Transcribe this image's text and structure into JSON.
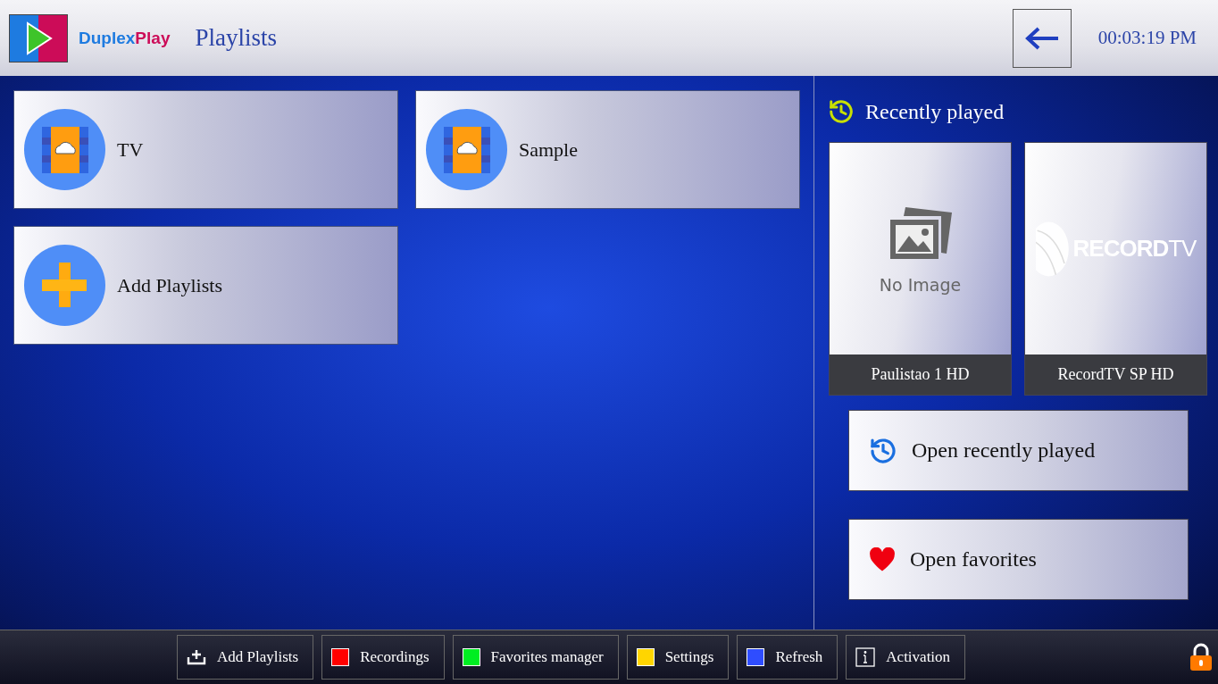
{
  "header": {
    "logo_first": "Duplex",
    "logo_second": "Play",
    "title": "Playlists",
    "clock": "00:03:19 PM"
  },
  "playlists": [
    {
      "kind": "playlist",
      "label": "TV"
    },
    {
      "kind": "playlist",
      "label": "Sample"
    },
    {
      "kind": "add",
      "label": "Add Playlists"
    }
  ],
  "recent": {
    "title": "Recently played",
    "items": [
      {
        "kind": "no_image",
        "caption": "No Image",
        "name": "Paulistao 1 HD"
      },
      {
        "kind": "logo",
        "logo_bold": "RECORD",
        "logo_light": "TV",
        "name": "RecordTV SP HD"
      }
    ]
  },
  "actions": [
    {
      "kind": "history",
      "label": "Open recently played"
    },
    {
      "kind": "heart",
      "label": "Open favorites"
    }
  ],
  "bottom_bar": [
    {
      "kind": "add",
      "label": "Add Playlists"
    },
    {
      "kind": "color",
      "color": "#ff0000",
      "label": "Recordings"
    },
    {
      "kind": "color",
      "color": "#00ee22",
      "label": "Favorites manager"
    },
    {
      "kind": "color",
      "color": "#ffd500",
      "label": "Settings"
    },
    {
      "kind": "color",
      "color": "#2f4dff",
      "label": "Refresh"
    },
    {
      "kind": "info",
      "label": "Activation"
    }
  ]
}
